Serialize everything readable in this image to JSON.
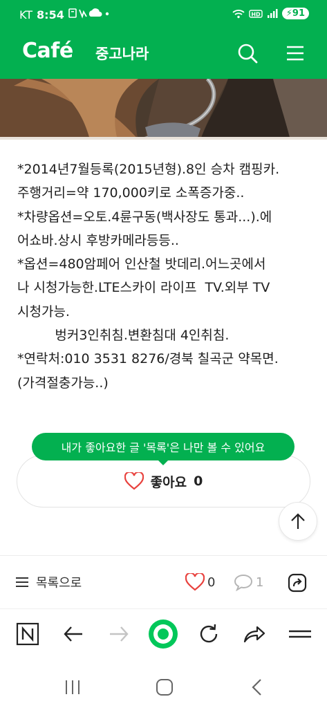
{
  "status_bar": {
    "carrier": "KT",
    "time": "8:54",
    "battery": "91"
  },
  "header": {
    "logo": "Café",
    "cafe_name": "중고나라"
  },
  "post": {
    "lines": [
      "*2014년7월등록(2015년형).8인 승차 캠핑카.",
      "주행거리=약 170,000키로 소폭증가중..",
      "*차량옵션=오토.4륜구동(백사장도 통과...).에",
      "어쇼바.상시 후방카메라등등..",
      "*옵션=480암페어 인산철 밧데리.어느곳에서",
      "나 시청가능한.LTE스카이 라이프  TV.외부 TV",
      "시청가능.",
      "         벙커3인취침.변환침대 4인취침.",
      "*연락처:010 3531 8276/경북 칠곡군 약목면.",
      "(가격절충가능..)"
    ]
  },
  "tooltip": "내가 좋아요한 글 '목록'은 나만 볼 수 있어요",
  "like_button": {
    "label": "좋아요",
    "count": "0"
  },
  "footer": {
    "list_label": "목록으로",
    "like_count": "0",
    "comment_count": "1"
  },
  "colors": {
    "brand_green": "#03b050",
    "like_red": "#e8413d"
  },
  "icons": {
    "header": [
      "search-icon",
      "menu-icon"
    ],
    "browser": [
      "naver-n-icon",
      "back-arrow-icon",
      "forward-arrow-icon",
      "green-home-icon",
      "refresh-icon",
      "share-arrow-icon",
      "browser-menu-icon"
    ],
    "system": [
      "recents-icon",
      "home-icon",
      "back-icon"
    ]
  }
}
